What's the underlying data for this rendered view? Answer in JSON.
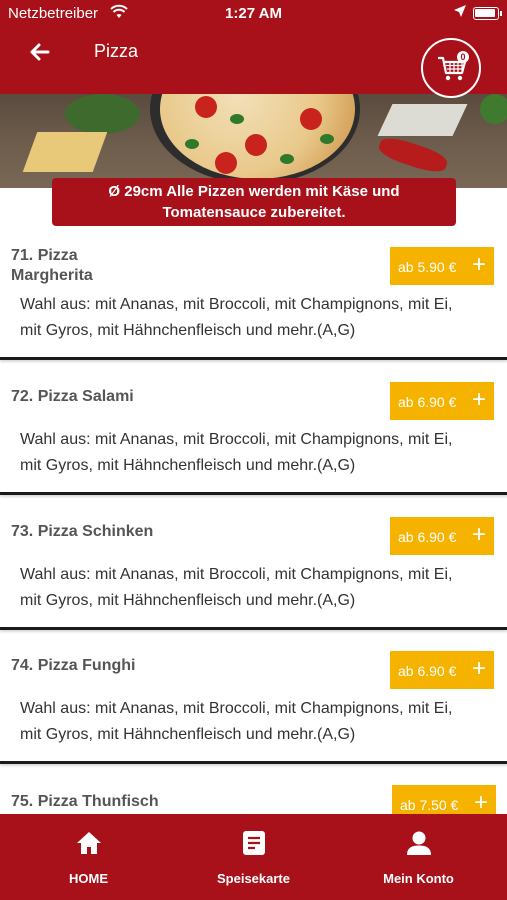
{
  "status_bar": {
    "carrier": "Netzbetreiber",
    "time": "1:27 AM"
  },
  "header": {
    "title": "Pizza",
    "cart_count": "0"
  },
  "banner": {
    "line1": "Ø 29cm Alle Pizzen werden mit Käse und",
    "line2": "Tomatensauce zubereitet."
  },
  "menu": {
    "items": [
      {
        "name_line1": "71. Pizza",
        "name_line2": "Margherita",
        "price": "ab 5.90 €",
        "desc_line1": "Wahl aus: mit Ananas, mit Broccoli, mit Champignons, mit Ei,",
        "desc_line2": "mit Gyros, mit Hähnchenfleisch und mehr.(A,G)"
      },
      {
        "name_line1": "72. Pizza Salami",
        "name_line2": "",
        "price": "ab 6.90 €",
        "desc_line1": "Wahl aus: mit Ananas, mit Broccoli, mit Champignons, mit Ei,",
        "desc_line2": "mit Gyros, mit Hähnchenfleisch und mehr.(A,G)"
      },
      {
        "name_line1": "73. Pizza Schinken",
        "name_line2": "",
        "price": "ab 6.90 €",
        "desc_line1": "Wahl aus: mit Ananas, mit Broccoli, mit Champignons, mit Ei,",
        "desc_line2": "mit Gyros, mit Hähnchenfleisch und mehr.(A,G)"
      },
      {
        "name_line1": "74. Pizza Funghi",
        "name_line2": "",
        "price": "ab 6.90 €",
        "desc_line1": "Wahl aus: mit Ananas, mit Broccoli, mit Champignons, mit Ei,",
        "desc_line2": "mit Gyros, mit Hähnchenfleisch und mehr.(A,G)"
      },
      {
        "name_line1": "75. Pizza Thunfisch",
        "name_line2": "",
        "price": "ab 7.50 €",
        "desc_line1": "",
        "desc_line2": ""
      }
    ]
  },
  "tab_bar": {
    "tabs": [
      {
        "label": "HOME",
        "icon": "home-icon"
      },
      {
        "label": "Speisekarte",
        "icon": "menu-list-icon"
      },
      {
        "label": "Mein Konto",
        "icon": "user-icon"
      }
    ]
  },
  "colors": {
    "brand_red": "#a8111a",
    "price_orange": "#f5b300"
  }
}
